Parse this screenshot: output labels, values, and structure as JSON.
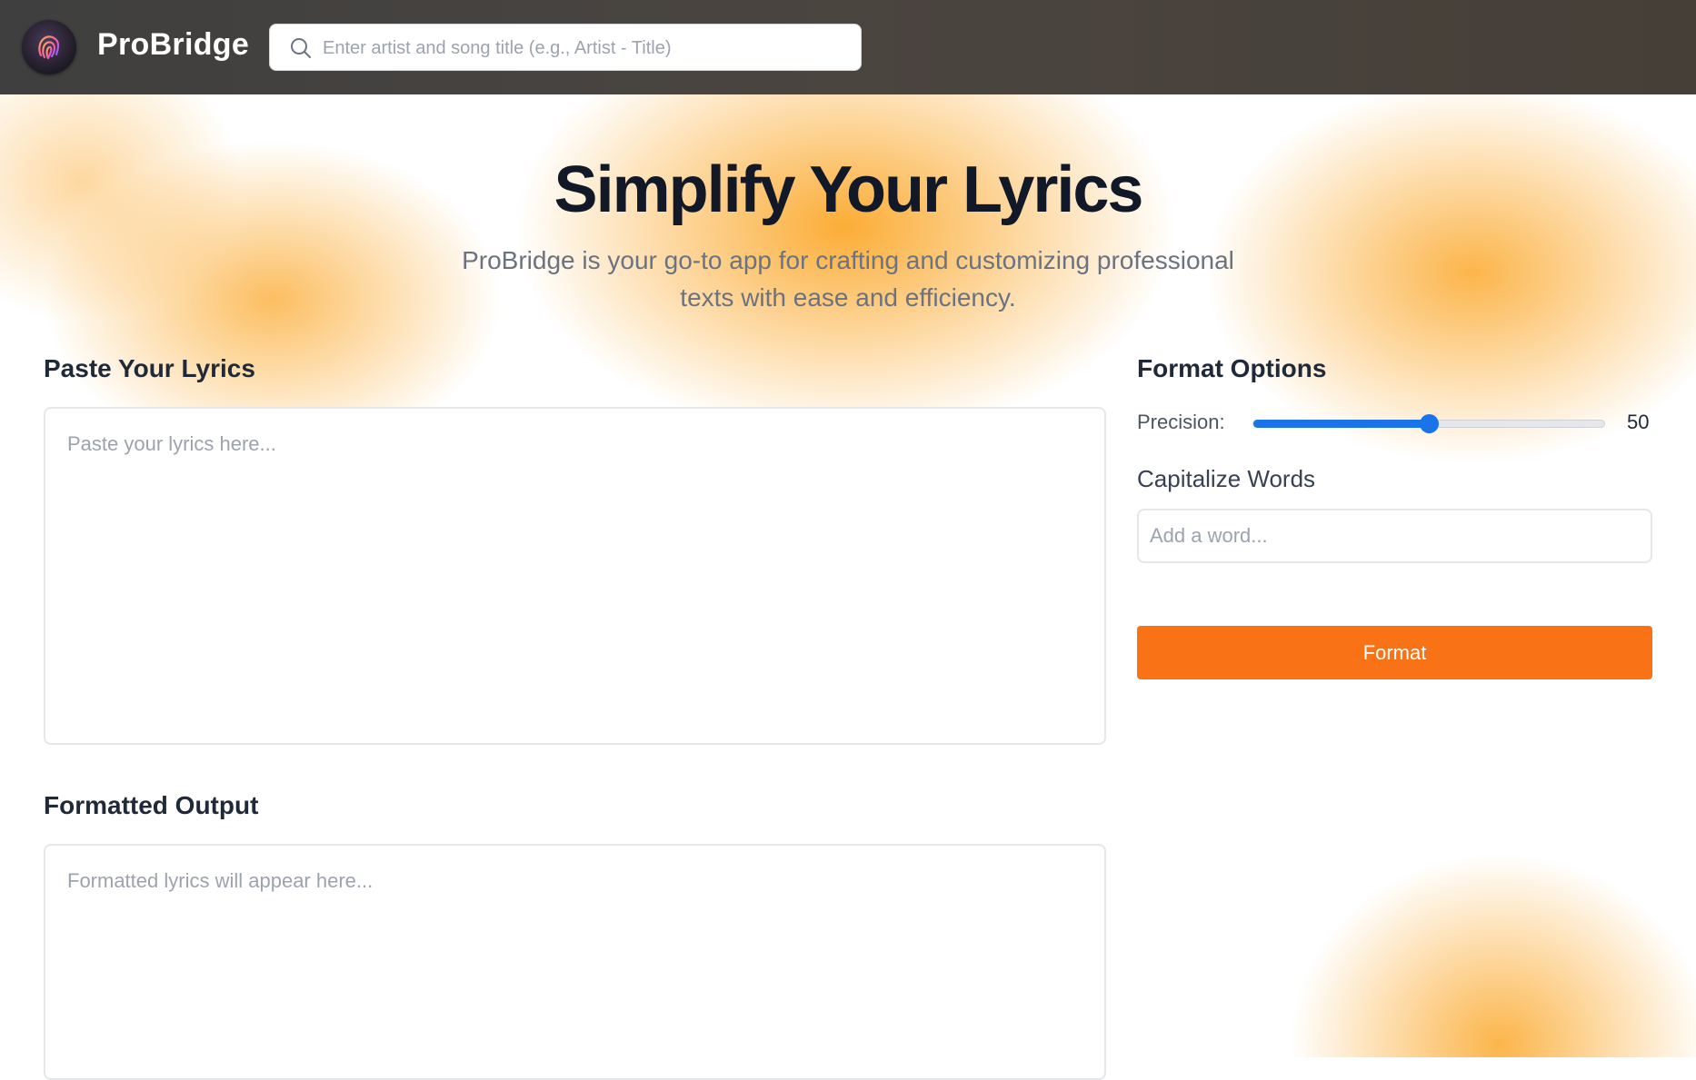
{
  "header": {
    "brand": "ProBridge",
    "search_placeholder": "Enter artist and song title (e.g., Artist - Title)"
  },
  "hero": {
    "title": "Simplify Your Lyrics",
    "subtitle_line1": "ProBridge is your go-to app for crafting and customizing professional",
    "subtitle_line2": "texts with ease and efficiency."
  },
  "lyrics_input": {
    "label": "Paste Your Lyrics",
    "placeholder": "Paste your lyrics here..."
  },
  "output": {
    "label": "Formatted Output",
    "placeholder": "Formatted lyrics will appear here..."
  },
  "format_options": {
    "label": "Format Options",
    "precision_label": "Precision:",
    "precision_value": "50",
    "precision_fraction": 0.5,
    "capitalize_label": "Capitalize Words",
    "word_placeholder": "Add a word...",
    "format_button": "Format"
  },
  "colors": {
    "accent": "#f97316",
    "slider": "#1a73e8",
    "glow": "#fba82b"
  },
  "icons": {
    "logo": "fingerprint-icon",
    "search": "search-icon"
  }
}
